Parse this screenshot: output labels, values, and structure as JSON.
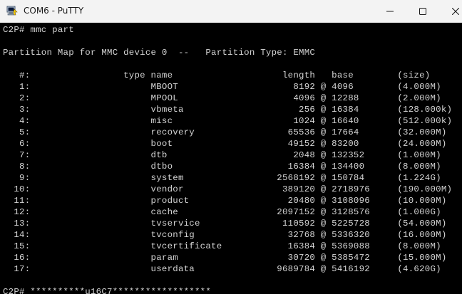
{
  "window": {
    "title": "COM6 - PuTTY",
    "controls": {
      "minimize": "minimize-icon",
      "maximize": "maximize-icon",
      "close": "close-icon"
    }
  },
  "terminal": {
    "lines": [
      "C2P# mmc part",
      "",
      "Partition Map for MMC device 0  --   Partition Type: EMMC",
      "",
      "   #:                 type name                    length   base        (size)",
      "   1:                      MBOOT                     8192 @ 4096        (4.000M)",
      "   2:                      MPOOL                     4096 @ 12288       (2.000M)",
      "   3:                      vbmeta                     256 @ 16384       (128.000k)",
      "   4:                      misc                      1024 @ 16640       (512.000k)",
      "   5:                      recovery                 65536 @ 17664       (32.000M)",
      "   6:                      boot                     49152 @ 83200       (24.000M)",
      "   7:                      dtb                       2048 @ 132352      (1.000M)",
      "   8:                      dtbo                     16384 @ 134400      (8.000M)",
      "   9:                      system                 2568192 @ 150784      (1.224G)",
      "  10:                      vendor                  389120 @ 2718976     (190.000M)",
      "  11:                      product                  20480 @ 3108096     (10.000M)",
      "  12:                      cache                  2097152 @ 3128576     (1.000G)",
      "  13:                      tvservice               110592 @ 5225728     (54.000M)",
      "  14:                      tvconfig                 32768 @ 5336320     (16.000M)",
      "  15:                      tvcertificate            16384 @ 5369088     (8.000M)",
      "  16:                      param                    30720 @ 5385472     (15.000M)",
      "  17:                      userdata               9689784 @ 5416192     (4.620G)",
      "",
      "C2P# **********u16C7******************"
    ]
  }
}
